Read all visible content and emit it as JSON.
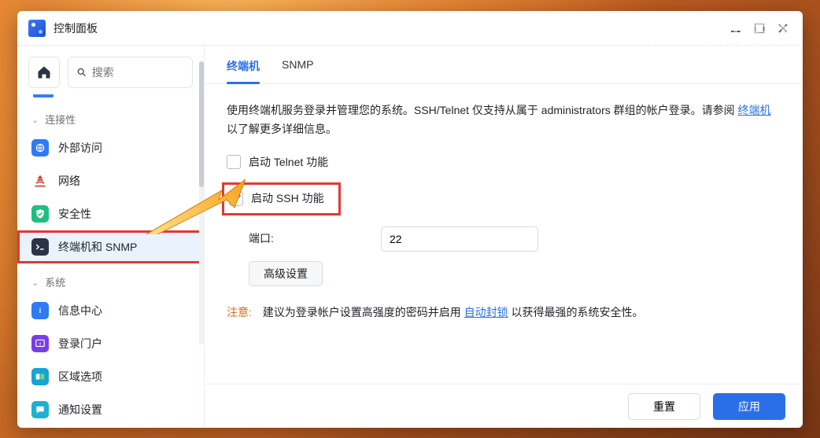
{
  "window": {
    "title": "控制面板"
  },
  "search": {
    "placeholder": "搜索"
  },
  "sidebar": {
    "sections": {
      "connectivity": {
        "label": "连接性"
      },
      "system": {
        "label": "系统"
      }
    },
    "items": {
      "external": "外部访问",
      "network": "网络",
      "security": "安全性",
      "terminal": "终端机和 SNMP",
      "info": "信息中心",
      "portal": "登录门户",
      "region": "区域选项",
      "notif": "通知设置"
    }
  },
  "tabs": {
    "terminal": "终端机",
    "snmp": "SNMP"
  },
  "main": {
    "intro_pre": "使用终端机服务登录并管理您的系统。SSH/Telnet 仅支持从属于 administrators 群组的帐户登录。请参阅 ",
    "intro_link": "终端机",
    "intro_post": " 以了解更多详细信息。",
    "telnet_label": "启动 Telnet 功能",
    "ssh_label": "启动 SSH 功能",
    "port_label": "端口:",
    "port_value": "22",
    "adv_btn": "高级设置",
    "note_label": "注意:",
    "note_pre": "建议为登录帐户设置高强度的密码并启用 ",
    "note_link": "自动封锁",
    "note_post": " 以获得最强的系统安全性。"
  },
  "footer": {
    "reset": "重置",
    "apply": "应用"
  },
  "watermark": {
    "title": "NAS研玩社",
    "url": "www.naslab.club"
  }
}
